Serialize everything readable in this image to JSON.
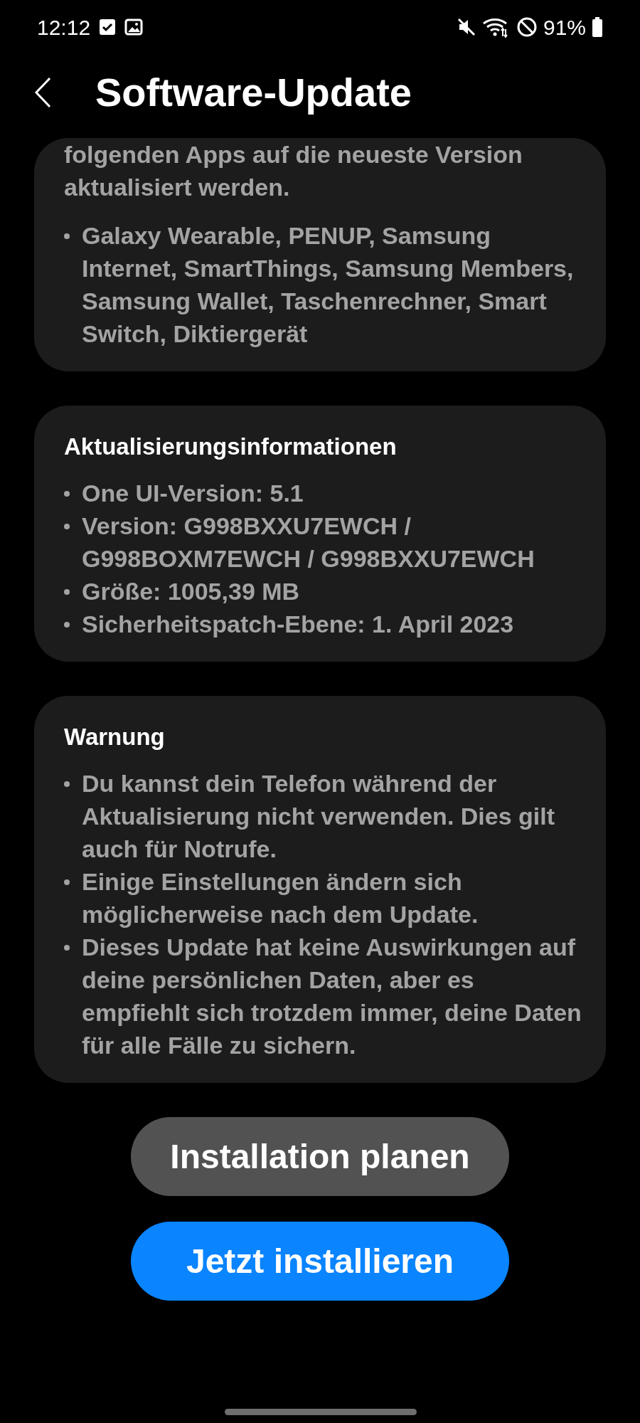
{
  "status_bar": {
    "time": "12:12",
    "battery": "91%"
  },
  "header": {
    "title": "Software-Update"
  },
  "cards": [
    {
      "text": "folgenden Apps auf die neueste Version aktualisiert werden.",
      "bullets": [
        "Galaxy Wearable, PENUP, Samsung Internet, SmartThings, Samsung Members, Samsung Wallet, Taschenrechner, Smart Switch, Diktiergerät"
      ]
    },
    {
      "title": "Aktualisierungsinformationen",
      "bullets": [
        "One UI-Version: 5.1",
        "Version: G998BXXU7EWCH / G998BOXM7EWCH / G998BXXU7EWCH",
        "Größe: 1005,39 MB",
        "Sicherheitspatch-Ebene: 1. April 2023"
      ]
    },
    {
      "title": "Warnung",
      "bullets": [
        "Du kannst dein Telefon während der Aktualisierung nicht verwenden. Dies gilt auch für Notrufe.",
        "Einige Einstellungen ändern sich möglicherweise nach dem Update.",
        "Dieses Update hat keine Auswirkungen auf deine persönlichen Daten, aber es empfiehlt sich trotzdem immer, deine Daten für alle Fälle zu sichern."
      ]
    }
  ],
  "buttons": [
    {
      "label": "Installation planen",
      "kind": "secondary"
    },
    {
      "label": "Jetzt installieren",
      "kind": "primary"
    }
  ]
}
